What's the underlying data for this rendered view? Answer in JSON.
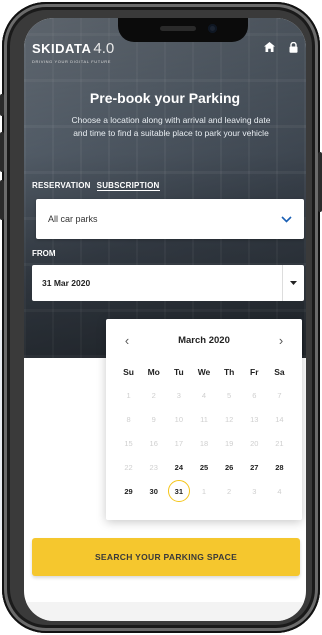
{
  "brand": {
    "name": "SKIDATA",
    "version": "4.0",
    "tagline": "DRIVING YOUR DIGITAL FUTURE"
  },
  "header_icons": [
    "home-icon",
    "lock-icon"
  ],
  "hero": {
    "title": "Pre-book your Parking",
    "subtitle": "Choose a location along with arrival and leaving date and time to find a suitable place to park your vehicle"
  },
  "tabs": [
    {
      "label": "RESERVATION",
      "active": false
    },
    {
      "label": "SUBSCRIPTION",
      "active": true
    }
  ],
  "car_park_select": {
    "value": "All car parks"
  },
  "from": {
    "label": "FROM",
    "value": "31 Mar 2020"
  },
  "calendar": {
    "month_label": "March 2020",
    "weekdays": [
      "Su",
      "Mo",
      "Tu",
      "We",
      "Th",
      "Fr",
      "Sa"
    ],
    "weeks": [
      [
        "1",
        "2",
        "3",
        "4",
        "5",
        "6",
        "7"
      ],
      [
        "8",
        "9",
        "10",
        "11",
        "12",
        "13",
        "14"
      ],
      [
        "15",
        "16",
        "17",
        "18",
        "19",
        "20",
        "21"
      ],
      [
        "22",
        "23",
        "24",
        "25",
        "26",
        "27",
        "28"
      ],
      [
        "29",
        "30",
        "31",
        "1",
        "2",
        "3",
        "4"
      ]
    ],
    "enabled": [
      "24",
      "25",
      "26",
      "27",
      "28",
      "29",
      "30",
      "31"
    ],
    "selected": "31"
  },
  "search_button": {
    "label": "SEARCH YOUR PARKING SPACE"
  },
  "colors": {
    "accent": "#f5c72e",
    "select_chevron": "#1a5fb4"
  }
}
